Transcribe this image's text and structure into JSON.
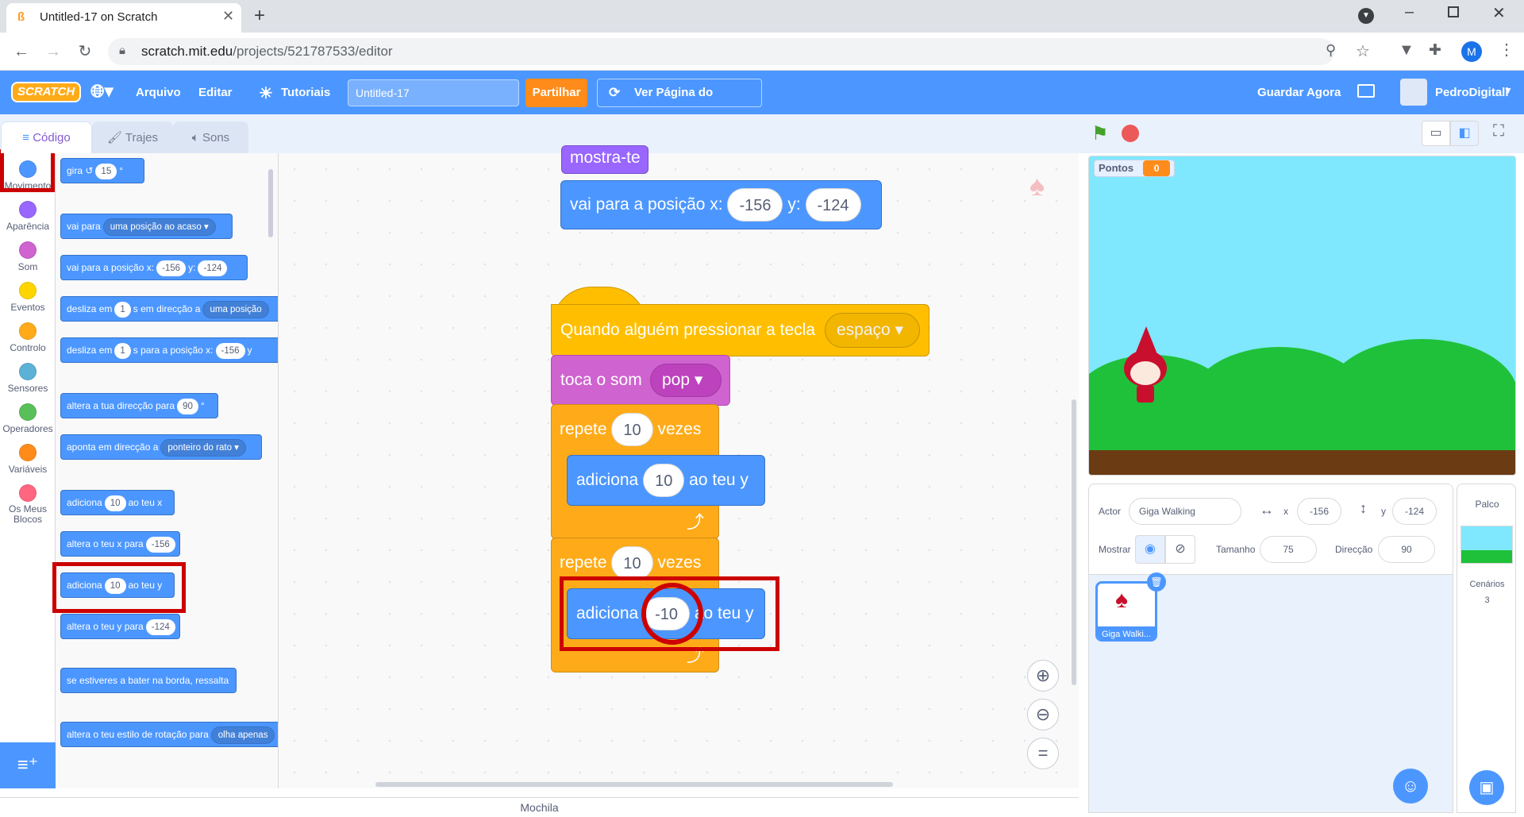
{
  "browser": {
    "tab_title": "Untitled-17 on Scratch",
    "url_host": "scratch.mit.edu",
    "url_path": "/projects/521787533/editor",
    "profile_initial": "M"
  },
  "menu": {
    "logo": "SCRATCH",
    "file": "Arquivo",
    "edit": "Editar",
    "tutorials": "Tutoriais",
    "project_title": "Untitled-17",
    "share": "Partilhar",
    "see_project": "Ver Página do Projecto",
    "save_now": "Guardar Agora",
    "username": "PedroDigitall"
  },
  "tabs": {
    "code": "Código",
    "costumes": "Trajes",
    "sounds": "Sons"
  },
  "categories": [
    {
      "label": "Movimento",
      "color": "#4c97ff"
    },
    {
      "label": "Aparência",
      "color": "#9966ff"
    },
    {
      "label": "Som",
      "color": "#cf63cf"
    },
    {
      "label": "Eventos",
      "color": "#ffd500"
    },
    {
      "label": "Controlo",
      "color": "#ffab19"
    },
    {
      "label": "Sensores",
      "color": "#5cb1d6"
    },
    {
      "label": "Operadores",
      "color": "#59c059"
    },
    {
      "label": "Variáveis",
      "color": "#ff8c1a"
    },
    {
      "label": "Os Meus Blocos",
      "color": "#ff6680"
    }
  ],
  "palette": {
    "turn": {
      "label": "gira",
      "value": "15",
      "unit": "°"
    },
    "goto": {
      "label": "vai para",
      "option": "uma posição ao acaso"
    },
    "gotoxy": {
      "label": "vai para a posição x:",
      "x": "-156",
      "ylabel": "y:",
      "y": "-124"
    },
    "glide1": {
      "label1": "desliza em",
      "secs": "1",
      "label2": "s em direcção a",
      "option": "uma posição"
    },
    "glide2": {
      "label1": "desliza em",
      "secs": "1",
      "label2": "s para a posição x:",
      "x": "-156",
      "ylabel": "y"
    },
    "point": {
      "label": "altera a tua direcção para",
      "value": "90",
      "unit": "°"
    },
    "pointto": {
      "label": "aponta em direcção a",
      "option": "ponteiro do rato"
    },
    "changex": {
      "label1": "adiciona",
      "value": "10",
      "label2": "ao teu x"
    },
    "setx": {
      "label": "altera o teu x para",
      "value": "-156"
    },
    "changey": {
      "label1": "adiciona",
      "value": "10",
      "label2": "ao teu y"
    },
    "sety": {
      "label": "altera o teu y para",
      "value": "-124"
    },
    "bounce": {
      "label": "se estiveres a bater na borda, ressalta"
    },
    "rotation": {
      "label": "altera o teu estilo de rotação para",
      "option": "olha apenas"
    }
  },
  "script": {
    "show": "mostra-te",
    "gotoxy": {
      "label": "vai para a posição x:",
      "x": "-156",
      "ylabel": "y:",
      "y": "-124"
    },
    "hat": {
      "label": "Quando alguém pressionar a tecla",
      "key": "espaço"
    },
    "sound": {
      "label": "toca o som",
      "value": "pop"
    },
    "repeat1": {
      "label1": "repete",
      "value": "10",
      "label2": "vezes"
    },
    "change1": {
      "label1": "adiciona",
      "value": "10",
      "label2": "ao teu y"
    },
    "repeat2": {
      "label1": "repete",
      "value": "10",
      "label2": "vezes"
    },
    "change2": {
      "label1": "adiciona",
      "value": "-10",
      "label2": "ao teu y"
    }
  },
  "stage": {
    "monitor_label": "Pontos",
    "monitor_value": "0"
  },
  "sprite_info": {
    "actor_label": "Actor",
    "actor_name": "Giga Walking",
    "x_label": "x",
    "x": "-156",
    "y_label": "y",
    "y": "-124",
    "show_label": "Mostrar",
    "size_label": "Tamanho",
    "size": "75",
    "direction_label": "Direcção",
    "direction": "90"
  },
  "sprite_list": [
    {
      "name": "Giga Walki..."
    }
  ],
  "stage_panel": {
    "title": "Palco",
    "backdrops_label": "Cenários",
    "backdrops_count": "3"
  },
  "backpack": "Mochila"
}
